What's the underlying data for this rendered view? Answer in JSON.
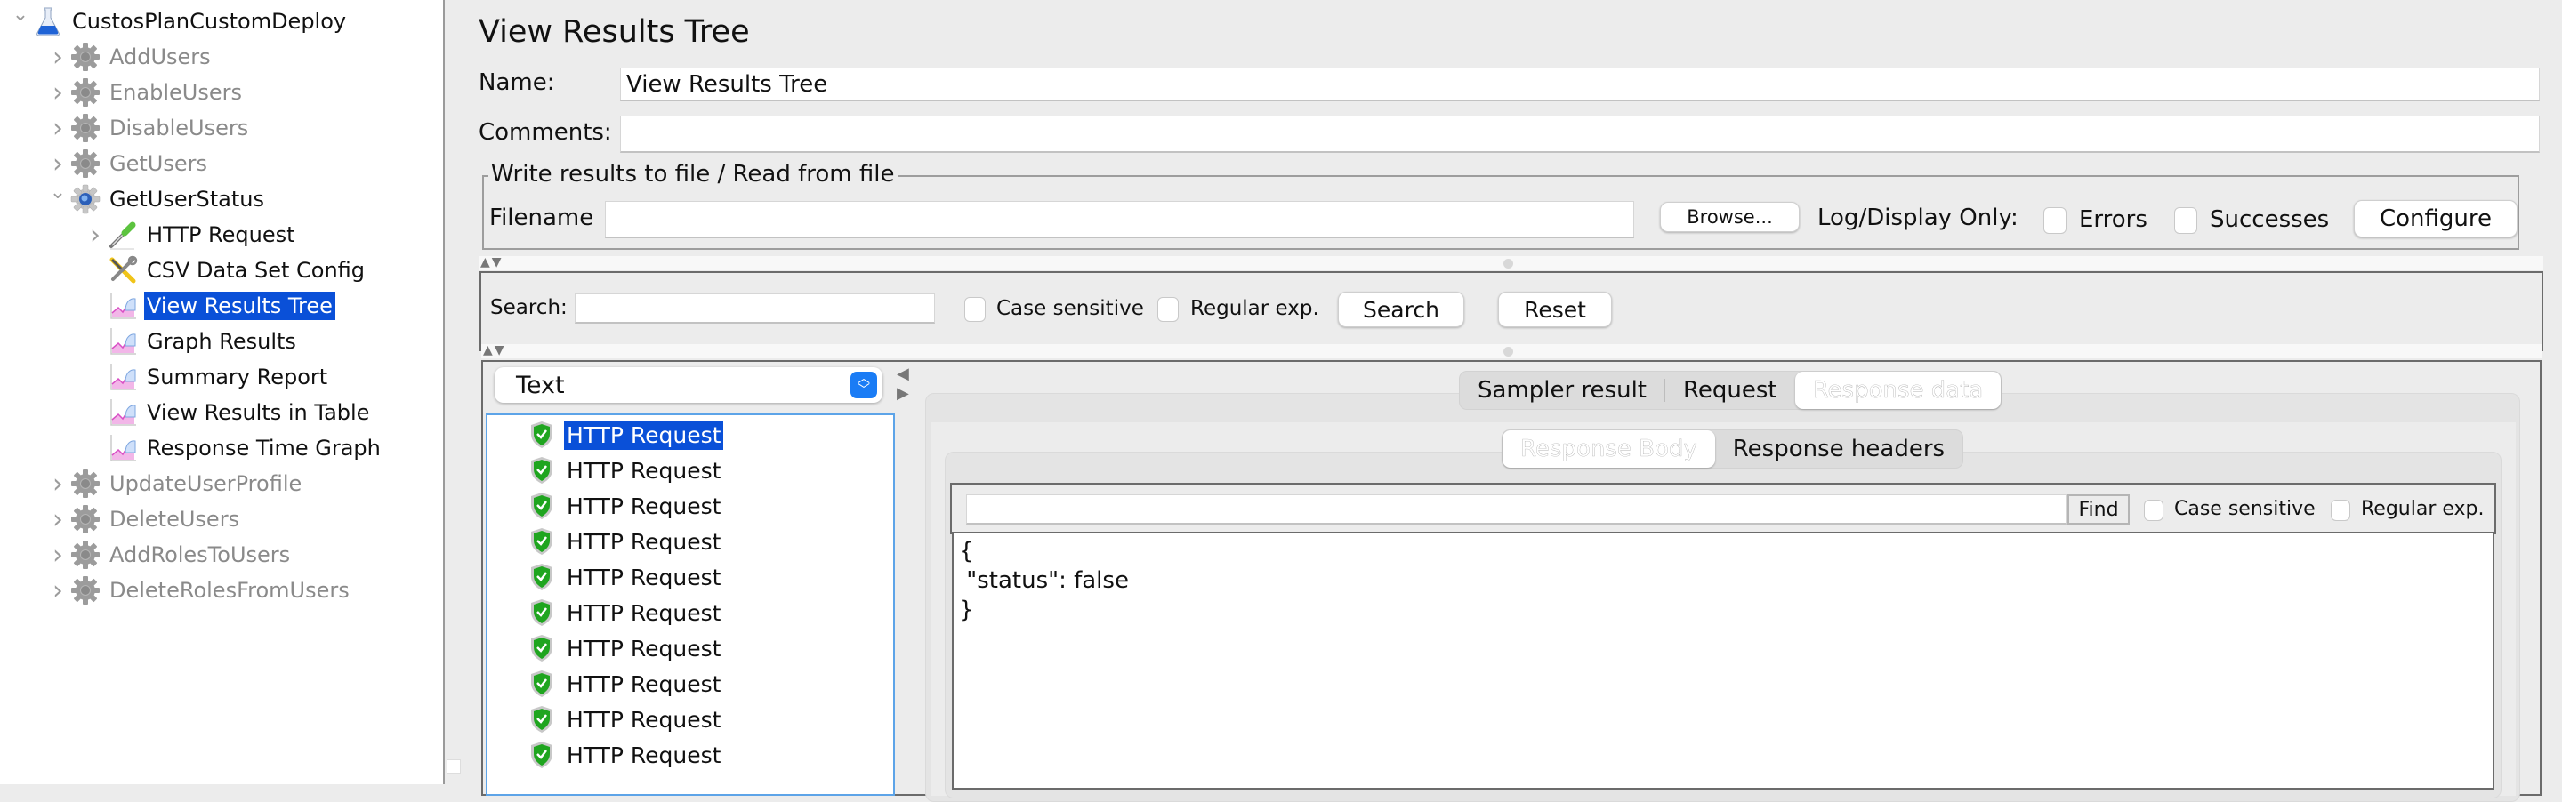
{
  "sidebar": {
    "tree": [
      {
        "label": "CustosPlanCustomDeploy",
        "icon": "flask-icon",
        "level": 0,
        "expanded": true,
        "disabled": false,
        "selected": false
      },
      {
        "label": "AddUsers",
        "icon": "gear-icon",
        "level": 1,
        "expanded": false,
        "disabled": true,
        "selected": false
      },
      {
        "label": "EnableUsers",
        "icon": "gear-icon",
        "level": 1,
        "expanded": false,
        "disabled": true,
        "selected": false
      },
      {
        "label": "DisableUsers",
        "icon": "gear-icon",
        "level": 1,
        "expanded": false,
        "disabled": true,
        "selected": false
      },
      {
        "label": "GetUsers",
        "icon": "gear-icon",
        "level": 1,
        "expanded": false,
        "disabled": true,
        "selected": false
      },
      {
        "label": "GetUserStatus",
        "icon": "thread-group-icon",
        "level": 1,
        "expanded": true,
        "disabled": false,
        "selected": false
      },
      {
        "label": "HTTP Request",
        "icon": "pipette-icon",
        "level": 2,
        "expanded": false,
        "disabled": false,
        "selected": false
      },
      {
        "label": "CSV Data Set Config",
        "icon": "tools-icon",
        "level": 2,
        "expanded": null,
        "disabled": false,
        "selected": false
      },
      {
        "label": "View Results Tree",
        "icon": "listener-graph-icon",
        "level": 2,
        "expanded": null,
        "disabled": false,
        "selected": true
      },
      {
        "label": "Graph Results",
        "icon": "listener-graph-icon",
        "level": 2,
        "expanded": null,
        "disabled": false,
        "selected": false
      },
      {
        "label": "Summary Report",
        "icon": "listener-graph-icon",
        "level": 2,
        "expanded": null,
        "disabled": false,
        "selected": false
      },
      {
        "label": "View Results in Table",
        "icon": "listener-graph-icon",
        "level": 2,
        "expanded": null,
        "disabled": false,
        "selected": false
      },
      {
        "label": "Response Time Graph",
        "icon": "listener-graph-icon",
        "level": 2,
        "expanded": null,
        "disabled": false,
        "selected": false
      },
      {
        "label": "UpdateUserProfile",
        "icon": "gear-icon",
        "level": 1,
        "expanded": false,
        "disabled": true,
        "selected": false
      },
      {
        "label": "DeleteUsers",
        "icon": "gear-icon",
        "level": 1,
        "expanded": false,
        "disabled": true,
        "selected": false
      },
      {
        "label": "AddRolesToUsers",
        "icon": "gear-icon",
        "level": 1,
        "expanded": false,
        "disabled": true,
        "selected": false
      },
      {
        "label": "DeleteRolesFromUsers",
        "icon": "gear-icon",
        "level": 1,
        "expanded": false,
        "disabled": true,
        "selected": false
      }
    ]
  },
  "main": {
    "title": "View Results Tree",
    "name_label": "Name:",
    "name_value": "View Results Tree",
    "comments_label": "Comments:",
    "comments_value": "",
    "file_group": {
      "title": "Write results to file / Read from file",
      "filename_label": "Filename",
      "filename_value": "",
      "browse_label": "Browse...",
      "log_display_label": "Log/Display Only:",
      "errors_label": "Errors",
      "errors_checked": false,
      "successes_label": "Successes",
      "successes_checked": false,
      "configure_label": "Configure"
    },
    "search": {
      "label": "Search:",
      "value": "",
      "case_sensitive_label": "Case sensitive",
      "case_sensitive_checked": false,
      "regex_label": "Regular exp.",
      "regex_checked": false,
      "search_button": "Search",
      "reset_button": "Reset"
    },
    "renderer": {
      "selected": "Text"
    },
    "results": [
      {
        "label": "HTTP Request",
        "status": "success",
        "selected": true
      },
      {
        "label": "HTTP Request",
        "status": "success",
        "selected": false
      },
      {
        "label": "HTTP Request",
        "status": "success",
        "selected": false
      },
      {
        "label": "HTTP Request",
        "status": "success",
        "selected": false
      },
      {
        "label": "HTTP Request",
        "status": "success",
        "selected": false
      },
      {
        "label": "HTTP Request",
        "status": "success",
        "selected": false
      },
      {
        "label": "HTTP Request",
        "status": "success",
        "selected": false
      },
      {
        "label": "HTTP Request",
        "status": "success",
        "selected": false
      },
      {
        "label": "HTTP Request",
        "status": "success",
        "selected": false
      },
      {
        "label": "HTTP Request",
        "status": "success",
        "selected": false
      }
    ],
    "tabs": [
      {
        "label": "Sampler result",
        "active": false
      },
      {
        "label": "Request",
        "active": false
      },
      {
        "label": "Response data",
        "active": true
      }
    ],
    "subtabs": [
      {
        "label": "Response Body",
        "active": true
      },
      {
        "label": "Response headers",
        "active": false
      }
    ],
    "find": {
      "value": "",
      "button": "Find",
      "case_sensitive_label": "Case sensitive",
      "case_sensitive_checked": false,
      "regex_label": "Regular exp.",
      "regex_checked": false
    },
    "response_body": "{\n \"status\": false\n}"
  },
  "colors": {
    "selection": "#0a50d8",
    "list_focus_border": "#5da4e8",
    "success_shield": "#1fa51f",
    "combo_accent": "#1a7cf5",
    "disabled_text": "#8a8a8a"
  }
}
